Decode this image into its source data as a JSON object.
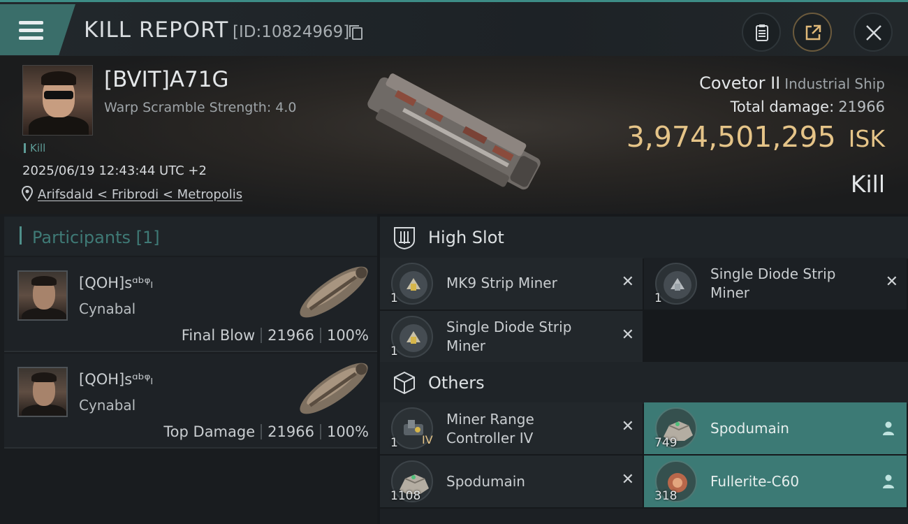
{
  "header": {
    "title": "KILL REPORT",
    "report_id": "[ID:10824969]"
  },
  "victim": {
    "name": "[BVIT]A71G",
    "warp_scramble": "Warp Scramble Strength: 4.0",
    "tag": "Kill",
    "datetime": "2025/06/19 12:43:44 UTC +2",
    "location": "Arifsdald < Fribrodi < Metropolis",
    "ship_name": "Covetor II",
    "ship_class": "Industrial Ship",
    "total_damage_label": "Total damage:",
    "total_damage": "21966",
    "isk_value": "3,974,501,295",
    "isk_unit": "ISK",
    "result": "Kill"
  },
  "participants": {
    "header": "Participants [1]",
    "rows": [
      {
        "name": "[QOH]sᵅᵇᵠₗ",
        "ship": "Cynabal",
        "role": "Final Blow",
        "damage": "21966",
        "percent": "100%"
      },
      {
        "name": "[QOH]sᵅᵇᵠₗ",
        "ship": "Cynabal",
        "role": "Top Damage",
        "damage": "21966",
        "percent": "100%"
      }
    ]
  },
  "high_slot": {
    "title": "High Slot",
    "items": [
      {
        "qty": "1",
        "name_line1": "MK9 Strip Miner",
        "name_line2": ""
      },
      {
        "qty": "1",
        "name_line1": "Single Diode Strip",
        "name_line2": "Miner"
      },
      {
        "qty": "1",
        "name_line1": "Single Diode Strip",
        "name_line2": "Miner"
      }
    ]
  },
  "others": {
    "title": "Others",
    "items": [
      {
        "qty": "1",
        "roman": "IV",
        "name_line1": "Miner Range",
        "name_line2": "Controller IV"
      },
      {
        "qty": "749",
        "name_line1": "Spodumain",
        "name_line2": ""
      },
      {
        "qty": "1108",
        "name_line1": "Spodumain",
        "name_line2": ""
      },
      {
        "qty": "318",
        "name_line1": "Fullerite-C60",
        "name_line2": ""
      }
    ]
  },
  "colors": {
    "accent_teal": "#3c7a75",
    "isk_gold": "#e5c488",
    "background": "#16191c"
  },
  "icons": [
    "menu-icon",
    "copy-icon",
    "clipboard-icon",
    "share-icon",
    "close-icon",
    "location-pin-icon",
    "high-slot-icon",
    "cube-icon",
    "destroyed-x-icon",
    "person-icon"
  ]
}
